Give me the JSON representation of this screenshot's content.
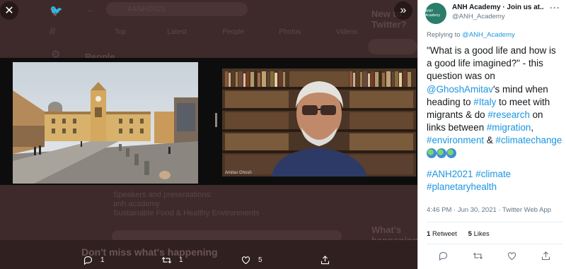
{
  "background": {
    "search_value": "#ANH2021",
    "tabs": [
      "Top",
      "Latest",
      "People",
      "Photos",
      "Videos"
    ],
    "people_heading": "People",
    "right_heading": "New to Twitter?",
    "whats_happening": "What's happening",
    "bottom_heading": "Don't miss what's happening",
    "faded_lines": [
      "Speakers and presentations:",
      "anh.academy",
      "Sustainable Food & Healthy Environments"
    ]
  },
  "media_viewer": {
    "close_icon": "close-icon",
    "collapse_icon": "chevron-double-right-icon",
    "video_label": "Amitav Ghosh",
    "actions": {
      "reply_count": "1",
      "retweet_count": "1",
      "like_count": "5"
    }
  },
  "tweet": {
    "author_name": "ANH Academy · Join us at...",
    "author_handle": "@ANH_Academy",
    "avatar_text": "ANH Academy",
    "replying_prefix": "Replying to ",
    "replying_to": "@ANH_Academy",
    "text": {
      "p1": "\"What is a good life and how is a good life imagined?\" - this question was on ",
      "mention": "@GhoshAmitav",
      "p2": "'s mind when heading to ",
      "tag_italy": "#Italy",
      "p3": " to meet with migrants & do ",
      "tag_research": "#research",
      "p4": " on links between ",
      "tag_migration": "#migration",
      "p5": ", ",
      "tag_environment": "#environment",
      "p6": " & ",
      "tag_climatechange": "#climatechange",
      "tag_anh2021": "#ANH2021",
      "tag_climate": "#climate",
      "tag_planetaryhealth": "#planetaryhealth"
    },
    "timestamp": "4:46 PM · Jun 30, 2021 · Twitter Web App",
    "retweets": "1",
    "retweets_label": "Retweet",
    "likes": "5",
    "likes_label": "Likes",
    "colors": {
      "link": "#1b95e0",
      "avatar": "#2a7d6a"
    }
  }
}
